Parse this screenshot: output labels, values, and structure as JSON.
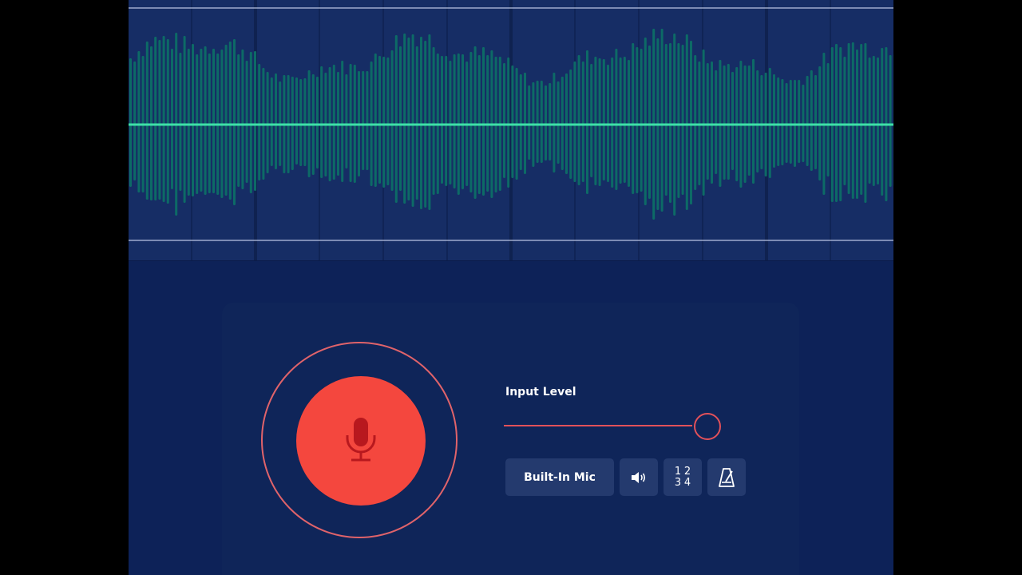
{
  "waveform": {
    "colors": {
      "background": "#162d65",
      "bar": "#0d6a66",
      "playhead": "#3ee0a8",
      "guide": "#b9c4e4",
      "divider": "#0b1a40"
    }
  },
  "recorder": {
    "input_level_label": "Input Level",
    "input_level": 0.88,
    "input_device": "Built-In Mic",
    "count_in": {
      "digits": [
        "1",
        "2",
        "3",
        "4"
      ]
    },
    "icons": {
      "record": "microphone-icon",
      "speaker": "speaker-icon",
      "count_in": "count-in-icon",
      "metronome": "metronome-icon"
    },
    "colors": {
      "record": "#f4473e",
      "accent": "#e2515a",
      "button_bg": "#243a6e"
    }
  }
}
